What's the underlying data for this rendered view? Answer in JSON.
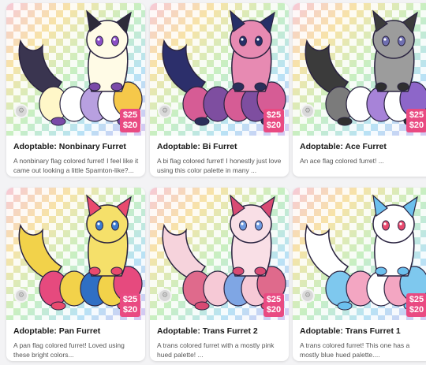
{
  "listings": [
    {
      "title": "Adoptable: Nonbinary Furret",
      "desc": "A nonbinary flag colored furret! I feel like it came out looking a little Spamton-like?...",
      "price_a": "$25",
      "price_b": "$20",
      "colors": {
        "tail": "#3a3550",
        "body": "#fffbe6",
        "stripes": [
          "#fff7c8",
          "#ffffff",
          "#b8a0e0",
          "#ffffff",
          "#f5c84a"
        ],
        "ear": "#2d2a3a",
        "eye": "#8b4fc7",
        "paw": "#7a4aa8"
      }
    },
    {
      "title": "Adoptable: Bi Furret",
      "desc": "A bi flag colored furret! I honestly just love using this color palette in many ...",
      "price_a": "$25",
      "price_b": "$20",
      "colors": {
        "tail": "#2c2f6b",
        "body": "#e78ab2",
        "stripes": [
          "#d65c95",
          "#7e4ea0",
          "#d65c95",
          "#7e4ea0",
          "#d65c95"
        ],
        "ear": "#263068",
        "eye": "#263068",
        "paw": "#2a2f5a"
      }
    },
    {
      "title": "Adoptable: Ace Furret",
      "desc": "An ace flag colored furret! ...",
      "price_a": "$25",
      "price_b": "$20",
      "colors": {
        "tail": "#3b3b3b",
        "body": "#9c9c9c",
        "stripes": [
          "#7b7b7b",
          "#ffffff",
          "#a783d8",
          "#ffffff",
          "#8d66c9"
        ],
        "ear": "#3b3b3b",
        "eye": "#6f6fb0",
        "paw": "#2f2f2f"
      }
    },
    {
      "title": "Adoptable: Pan Furret",
      "desc": "A pan flag colored furret! Loved using these bright colors...",
      "price_a": "$25",
      "price_b": "$20",
      "colors": {
        "tail": "#f2d24a",
        "body": "#f5e06a",
        "stripes": [
          "#e64a7e",
          "#f2d24a",
          "#2f6fc4",
          "#f2d24a",
          "#e64a7e"
        ],
        "ear": "#e94a6e",
        "eye": "#3b7bd1",
        "paw": "#e94a6e"
      }
    },
    {
      "title": "Adoptable: Trans Furret 2",
      "desc": "A trans colored furret with a mostly pink hued palette! ...",
      "price_a": "$25",
      "price_b": "$20",
      "colors": {
        "tail": "#f6d3dc",
        "body": "#f9dfe6",
        "stripes": [
          "#df6a8c",
          "#f6c9d6",
          "#7fa6e4",
          "#f6c9d6",
          "#df6a8c"
        ],
        "ear": "#d84a73",
        "eye": "#6f9be0",
        "paw": "#d84a73"
      }
    },
    {
      "title": "Adoptable: Trans Furret 1",
      "desc": "A trans colored furret! This one has a mostly blue hued palette....",
      "price_a": "$25",
      "price_b": "$20",
      "colors": {
        "tail": "#ffffff",
        "body": "#ffffff",
        "stripes": [
          "#7ec8ee",
          "#f3a6c2",
          "#ffffff",
          "#f3a6c2",
          "#7ec8ee"
        ],
        "ear": "#6cc0ee",
        "eye": "#e94a6e",
        "paw": "#6cc0ee"
      }
    }
  ]
}
